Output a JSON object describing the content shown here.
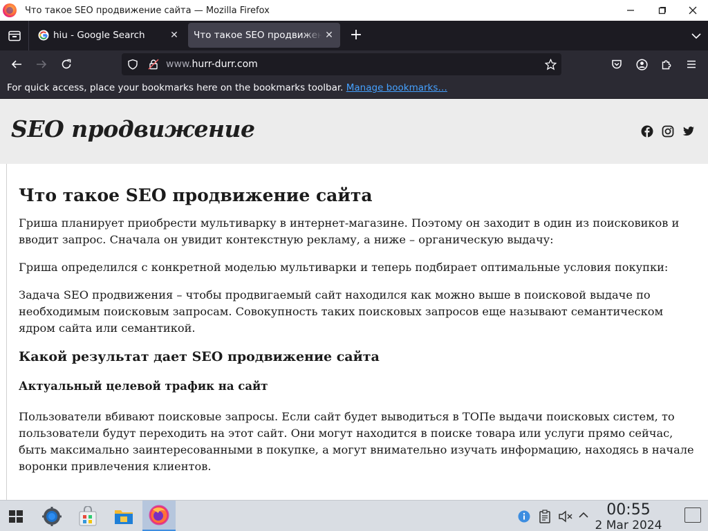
{
  "window": {
    "title": "Что такое SEO продвижение сайта — Mozilla Firefox",
    "minimize": "—",
    "maximize": "▢",
    "close": "✕"
  },
  "tabs": [
    {
      "label": "hiu - Google Search",
      "close": "✕",
      "favicon": "google-g-icon",
      "active": false
    },
    {
      "label": "Что такое SEO продвижение сайта",
      "close": "✕",
      "favicon": "none",
      "active": true
    }
  ],
  "new_tab": "+",
  "address_bar": {
    "url_prefix": "www.",
    "url_host": "hurr-durr.com"
  },
  "bookmarks_bar": {
    "text": "For quick access, place your bookmarks here on the bookmarks toolbar.",
    "link": "Manage bookmarks…"
  },
  "site": {
    "logo": "SEO продвижение",
    "social": [
      "facebook-icon",
      "instagram-icon",
      "twitter-icon"
    ]
  },
  "article": {
    "h1": "Что такое SEO продвижение сайта",
    "p1": "Гриша планирует приобрести мультиварку в интернет-магазине. Поэтому он заходит в один из поисковиков и вводит запрос. Сначала он увидит контекстную рекламу, а ниже – органическую выдачу:",
    "p2": "Гриша определился с конкретной моделью мультиварки и теперь подбирает оптимальные условия покупки:",
    "p3": "Задача SEO продвижения – чтобы продвигаемый сайт находился как можно выше в поисковой выдаче по необходимым поисковым запросам. Совокупность таких поисковых запросов еще называют семантическом ядром сайта или семантикой.",
    "h2": "Какой результат дает SEO продвижение сайта",
    "h3": "Актуальный целевой трафик на сайт",
    "p4": "Пользователи вбивают поисковые запросы. Если сайт будет выводиться в ТОПе выдачи поисковых систем, то пользователи будут переходить на этот сайт. Они могут находится в поиске товара или услуги прямо сейчас, быть максимально заинтересованными в покупке, а могут внимательно изучать информацию, находясь в начале воронки привлечения клиентов."
  },
  "taskbar": {
    "time": "00:55",
    "date": "2 Mar 2024",
    "apps": [
      "start-menu-icon",
      "system-settings-icon",
      "software-store-icon",
      "file-manager-icon",
      "firefox-icon"
    ]
  },
  "colors": {
    "tab_strip": "#1c1b22",
    "toolbar": "#2b2a33",
    "active_tab": "#42414d",
    "link": "#45a1ff",
    "site_header": "#ececec",
    "taskbar": "#d9dde3"
  }
}
